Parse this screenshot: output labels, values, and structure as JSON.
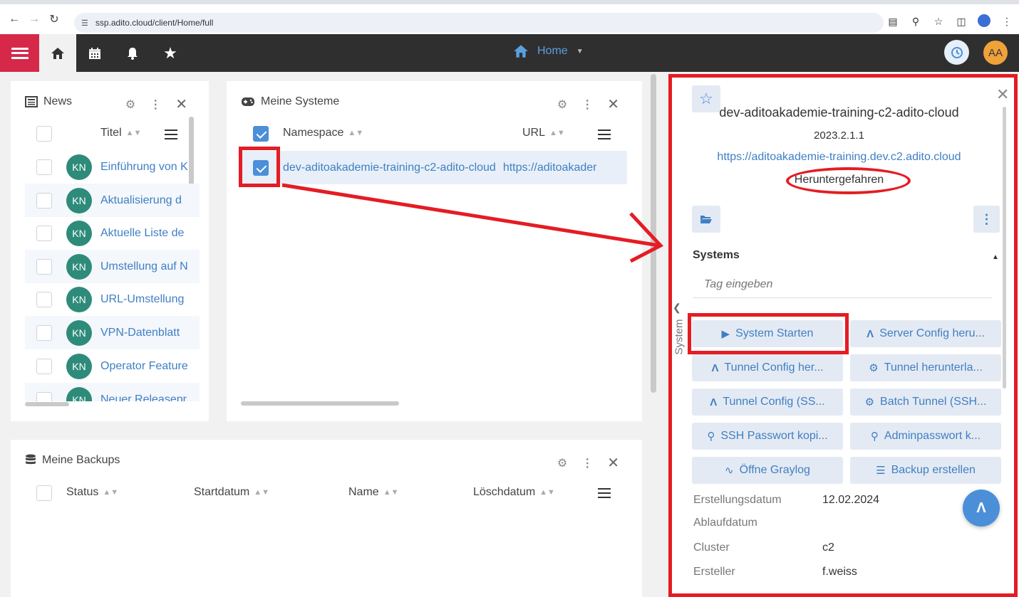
{
  "browser": {
    "url": "ssp.adito.cloud/client/Home/full"
  },
  "appbar": {
    "title": "Home",
    "avatar_initials": "AA"
  },
  "news": {
    "title": "News",
    "column": "Titel",
    "items": [
      {
        "initials": "KN",
        "title": "Einführung von K"
      },
      {
        "initials": "KN",
        "title": "Aktualisierung d"
      },
      {
        "initials": "KN",
        "title": "Aktuelle Liste de"
      },
      {
        "initials": "KN",
        "title": "Umstellung auf N"
      },
      {
        "initials": "KN",
        "title": "URL-Umstellung"
      },
      {
        "initials": "KN",
        "title": "VPN-Datenblatt"
      },
      {
        "initials": "KN",
        "title": "Operator Feature"
      },
      {
        "initials": "KN",
        "title": "Neuer Releasepr"
      }
    ]
  },
  "systems": {
    "title": "Meine Systeme",
    "columns": {
      "namespace": "Namespace",
      "url": "URL"
    },
    "rows": [
      {
        "namespace": "dev-aditoakademie-training-c2-adito-cloud",
        "url": "https://aditoakader"
      }
    ]
  },
  "backups": {
    "title": "Meine Backups",
    "columns": {
      "status": "Status",
      "start": "Startdatum",
      "name": "Name",
      "delete": "Löschdatum"
    }
  },
  "detail": {
    "name": "dev-aditoakademie-training-c2-adito-cloud",
    "version": "2023.2.1.1",
    "url": "https://aditoakademie-training.dev.c2.adito.cloud",
    "status": "Heruntergefahren",
    "section": "Systems",
    "tag_placeholder": "Tag eingeben",
    "side_tab": "System",
    "buttons": [
      {
        "label": "System Starten",
        "icon": "play-icon"
      },
      {
        "label": "Server Config heru...",
        "icon": "adito-icon"
      },
      {
        "label": "Tunnel Config her...",
        "icon": "adito-icon"
      },
      {
        "label": "Tunnel herunterla...",
        "icon": "gear-icon"
      },
      {
        "label": "Tunnel Config (SS...",
        "icon": "adito-icon"
      },
      {
        "label": "Batch Tunnel (SSH...",
        "icon": "gear-icon"
      },
      {
        "label": "SSH Passwort kopi...",
        "icon": "key-icon"
      },
      {
        "label": "Adminpasswort k...",
        "icon": "key-icon"
      },
      {
        "label": "Öffne Graylog",
        "icon": "pulse-icon"
      },
      {
        "label": "Backup erstellen",
        "icon": "database-icon"
      }
    ],
    "fields": [
      {
        "label": "Erstellungsdatum",
        "value": "12.02.2024"
      },
      {
        "label": "Ablaufdatum",
        "value": ""
      },
      {
        "label": "Cluster",
        "value": "c2"
      },
      {
        "label": "Ersteller",
        "value": "f.weiss"
      }
    ]
  },
  "annotation_color": "#e41c24",
  "accent_color": "#3f7fc4"
}
